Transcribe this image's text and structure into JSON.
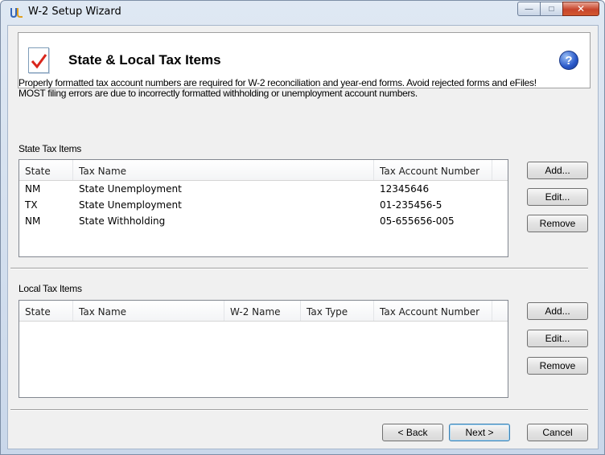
{
  "window": {
    "title": "W-2 Setup Wizard",
    "caption": {
      "minimize": "—",
      "maximize": "□",
      "close": "✕"
    }
  },
  "header": {
    "title": "State & Local Tax Items",
    "help_label": "?"
  },
  "intro": {
    "line1": "Properly formatted tax account numbers are required for W-2 reconciliation and year-end forms. Avoid rejected forms and eFiles!",
    "line2": "MOST filing errors are due to incorrectly formatted withholding or unemployment account numbers."
  },
  "state_section": {
    "label": "State Tax Items",
    "columns": [
      "State",
      "Tax Name",
      "Tax Account Number"
    ],
    "rows": [
      {
        "state": "NM",
        "tax_name": "State Unemployment",
        "account": "12345646"
      },
      {
        "state": "TX",
        "tax_name": "State Unemployment",
        "account": "01-235456-5"
      },
      {
        "state": "NM",
        "tax_name": "State Withholding",
        "account": "05-655656-005"
      }
    ],
    "buttons": {
      "add": "Add...",
      "edit": "Edit...",
      "remove": "Remove"
    }
  },
  "local_section": {
    "label": "Local Tax Items",
    "columns": [
      "State",
      "Tax Name",
      "W-2 Name",
      "Tax Type",
      "Tax Account Number"
    ],
    "rows": [],
    "buttons": {
      "add": "Add...",
      "edit": "Edit...",
      "remove": "Remove"
    }
  },
  "footer": {
    "back": "< Back",
    "next": "Next >",
    "cancel": "Cancel"
  },
  "colors": {
    "accent": "#3c7fb1",
    "close_button": "#c7452c",
    "help_icon": "#2958c9"
  }
}
